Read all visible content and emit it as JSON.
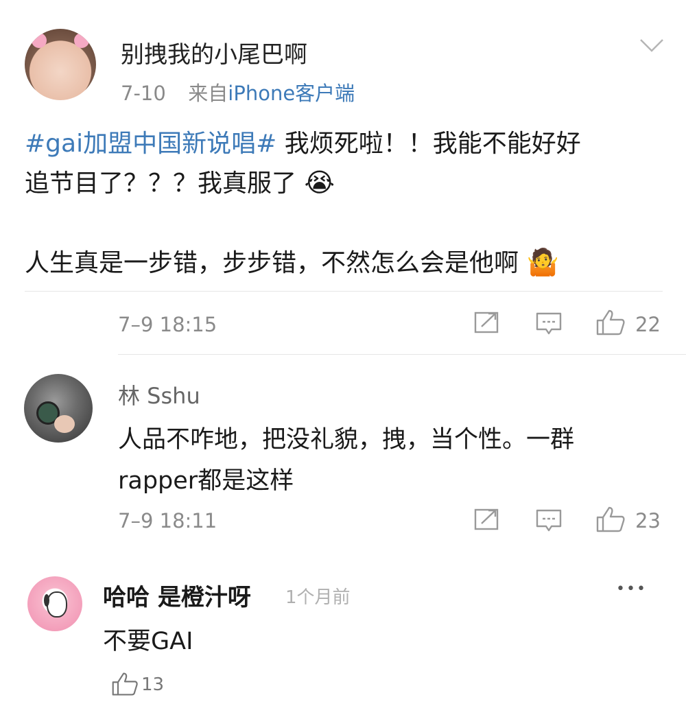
{
  "post": {
    "username": "别拽我的小尾巴啊",
    "date": "7-10",
    "source_prefix": "来自",
    "source_device": "iPhone客户端",
    "hashtag": "#gai加盟中国新说唱#",
    "line1_rest": " 我烦死啦！！我能不能好好",
    "line2": "追节目了？？？我真服了",
    "emoji_cry": "😭",
    "line3": "人生真是一步错，步步错，不然怎么会是他啊",
    "emoji_shrug": "🤷"
  },
  "reply1": {
    "meta_time": "7–9 18:15",
    "like_count": "22"
  },
  "reply2": {
    "username": "林 Sshu",
    "text_line1": "人品不咋地，把没礼貌，拽，当个性。一群",
    "text_line2": "rapper都是这样",
    "meta_time": "7–9 18:11",
    "like_count": "23"
  },
  "reply3": {
    "username": "哈哈 是橙汁呀",
    "time_ago": "1个月前",
    "text": "不要GAI",
    "like_count": "13",
    "more": "•••"
  },
  "colors": {
    "link": "#3d7ab8",
    "gray": "#8a8a8a",
    "divider": "#e6e6e6"
  }
}
